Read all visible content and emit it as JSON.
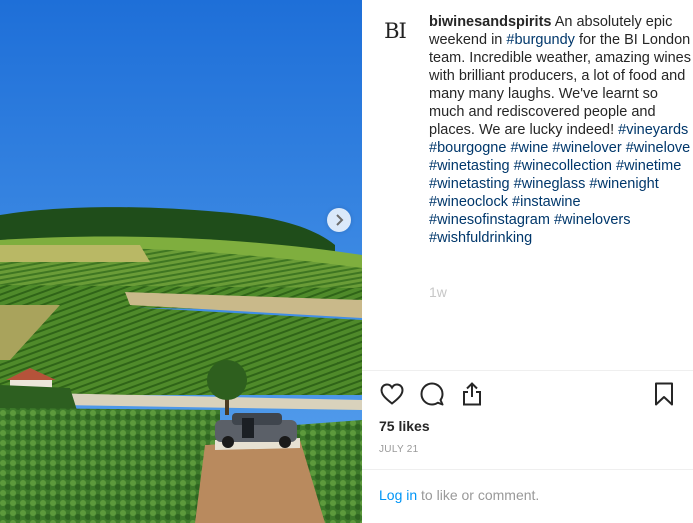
{
  "post": {
    "username": "biwinesandspirits",
    "avatar_text": "BI",
    "caption_segments": [
      {
        "text": " An absolutely epic weekend in ",
        "tag": false
      },
      {
        "text": "#burgundy",
        "tag": true
      },
      {
        "text": " for the BI London team. Incredible weather, amazing wines with brilliant producers, a lot of food and many many laughs. We've learnt so much and rediscovered people and places. We are lucky indeed! ",
        "tag": false
      },
      {
        "text": "#vineyards",
        "tag": true
      },
      {
        "text": " ",
        "tag": false
      },
      {
        "text": "#bourgogne",
        "tag": true
      },
      {
        "text": " ",
        "tag": false
      },
      {
        "text": "#wine",
        "tag": true
      },
      {
        "text": " ",
        "tag": false
      },
      {
        "text": "#winelover",
        "tag": true
      },
      {
        "text": " ",
        "tag": false
      },
      {
        "text": "#winelove",
        "tag": true
      },
      {
        "text": " ",
        "tag": false
      },
      {
        "text": "#winetasting",
        "tag": true
      },
      {
        "text": " ",
        "tag": false
      },
      {
        "text": "#winecollection",
        "tag": true
      },
      {
        "text": " ",
        "tag": false
      },
      {
        "text": "#winetime",
        "tag": true
      },
      {
        "text": " ",
        "tag": false
      },
      {
        "text": "#winetasting",
        "tag": true
      },
      {
        "text": " ",
        "tag": false
      },
      {
        "text": "#wineglass",
        "tag": true
      },
      {
        "text": " ",
        "tag": false
      },
      {
        "text": "#winenight",
        "tag": true
      },
      {
        "text": " ",
        "tag": false
      },
      {
        "text": "#wineoclock",
        "tag": true
      },
      {
        "text": " ",
        "tag": false
      },
      {
        "text": "#instawine",
        "tag": true
      },
      {
        "text": " ",
        "tag": false
      },
      {
        "text": "#winesofinstagram",
        "tag": true
      },
      {
        "text": " ",
        "tag": false
      },
      {
        "text": "#winelovers",
        "tag": true
      },
      {
        "text": " ",
        "tag": false
      },
      {
        "text": "#wishfuldrinking",
        "tag": true
      }
    ],
    "time_ago": "1w",
    "likes": "75 likes",
    "date": "JULY 21"
  },
  "footer": {
    "login_link": "Log in",
    "login_rest": " to like or comment."
  },
  "icons": {
    "like": "heart-icon",
    "comment": "comment-icon",
    "share": "share-icon",
    "save": "bookmark-icon",
    "next": "chevron-right-icon"
  },
  "colors": {
    "hashtag": "#00376b",
    "link": "#0095f6",
    "muted": "#999999",
    "sky": "#2f7fe0"
  }
}
